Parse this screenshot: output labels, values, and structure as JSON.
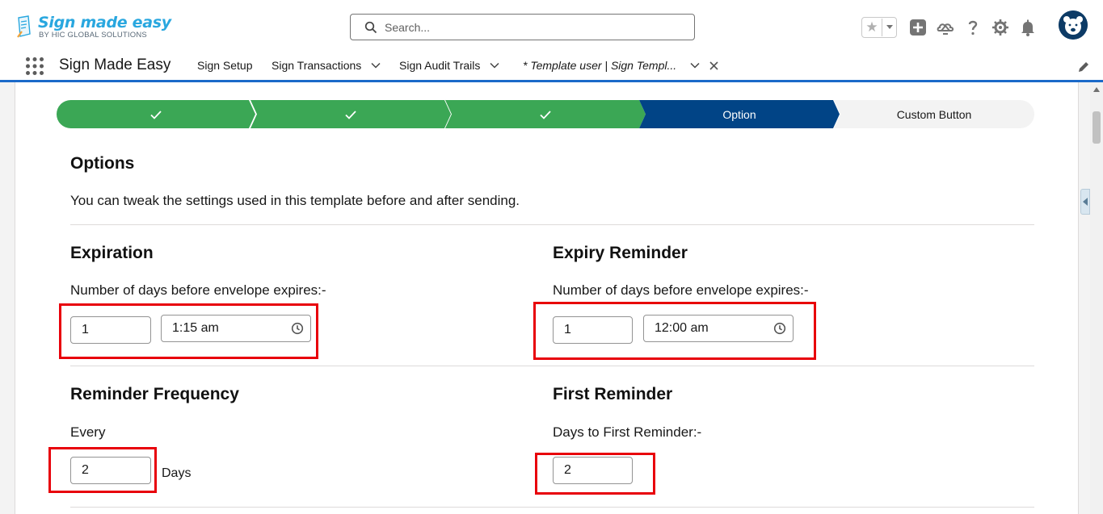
{
  "header": {
    "logo_title": "Sign made easy",
    "logo_subtitle": "BY HIC GLOBAL SOLUTIONS",
    "search_placeholder": "Search..."
  },
  "icons": {
    "search": "search-icon",
    "favorites": "star-icon",
    "favorites_menu": "chevron-down-icon",
    "global_actions": "plus-icon",
    "trailhead": "cloud-mountain-icon",
    "help": "question-icon",
    "setup": "gear-icon",
    "notifications": "bell-icon",
    "avatar": "bear-avatar-icon",
    "app_launcher": "waffle-icon",
    "edit_nav": "pencil-icon",
    "clock": "clock-icon",
    "check": "check-icon"
  },
  "nav": {
    "app_name": "Sign Made Easy",
    "items": [
      {
        "label": "Sign Setup",
        "has_menu": false
      },
      {
        "label": "Sign Transactions",
        "has_menu": true
      },
      {
        "label": "Sign Audit Trails",
        "has_menu": true
      }
    ],
    "active_tab": {
      "label": "* Template user | Sign Templ...",
      "closable": true
    }
  },
  "path": {
    "steps": [
      {
        "label": "",
        "state": "complete"
      },
      {
        "label": "",
        "state": "complete"
      },
      {
        "label": "",
        "state": "complete"
      },
      {
        "label": "Option",
        "state": "current"
      },
      {
        "label": "Custom Button",
        "state": "incomplete"
      }
    ]
  },
  "options": {
    "title": "Options",
    "description": "You can tweak the settings used in this template before and after sending."
  },
  "expiration": {
    "title": "Expiration",
    "label": "Number of days before envelope expires:-",
    "days": "1",
    "time": "1:15 am"
  },
  "expiry_reminder": {
    "title": "Expiry Reminder",
    "label": "Number of days before envelope expires:-",
    "days": "1",
    "time": "12:00 am"
  },
  "reminder_frequency": {
    "title": "Reminder Frequency",
    "label": "Every",
    "value": "2",
    "unit": "Days"
  },
  "first_reminder": {
    "title": "First Reminder",
    "label": "Days to First Reminder:-",
    "value": "2"
  },
  "colors": {
    "complete": "#3ba755",
    "current": "#014486",
    "highlight": "#e8000a",
    "nav_accent": "#1b6ac9"
  }
}
